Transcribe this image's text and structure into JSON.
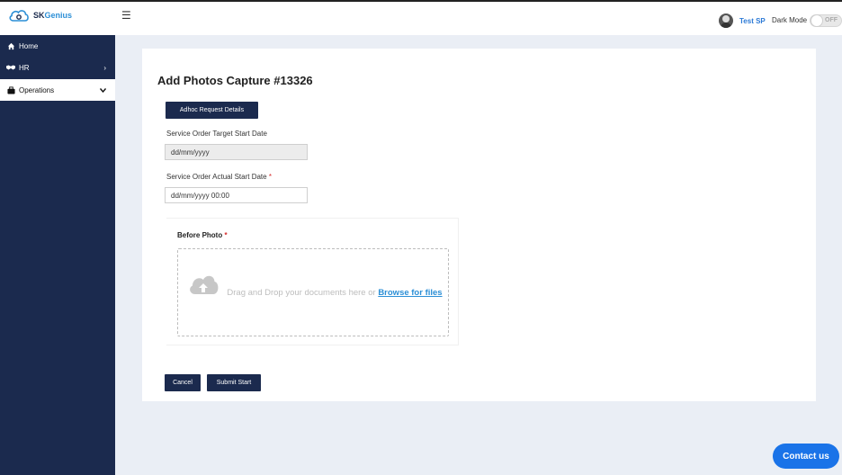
{
  "brand": {
    "part1": "SK",
    "part2": "Genius"
  },
  "header": {
    "user_name": "Test SP",
    "dark_mode_label": "Dark Mode",
    "toggle_state": "OFF"
  },
  "sidebar": {
    "items": [
      {
        "label": "Home",
        "icon": "home-icon"
      },
      {
        "label": "HR",
        "icon": "handshake-icon"
      },
      {
        "label": "Operations",
        "icon": "briefcase-icon"
      }
    ]
  },
  "main": {
    "title": "Add Photos Capture #13326",
    "adhoc_button": "Adhoc Request Details",
    "target_start_label": "Service Order Target Start Date",
    "target_start_value": "dd/mm/yyyy",
    "actual_start_label": "Service Order Actual Start Date",
    "actual_start_value": "dd/mm/yyyy 00:00",
    "required_mark": "*",
    "before_photo_label": "Before Photo",
    "drop_text": "Drag and Drop your documents here or",
    "browse_text": "Browse for files",
    "cancel_button": "Cancel",
    "submit_button": "Submit Start"
  },
  "contact_button": "Contact us",
  "colors": {
    "sidebar_bg": "#1b2a4e",
    "accent": "#2c8fd6",
    "contact_bg": "#1a73e8",
    "required": "#d62d2d"
  }
}
